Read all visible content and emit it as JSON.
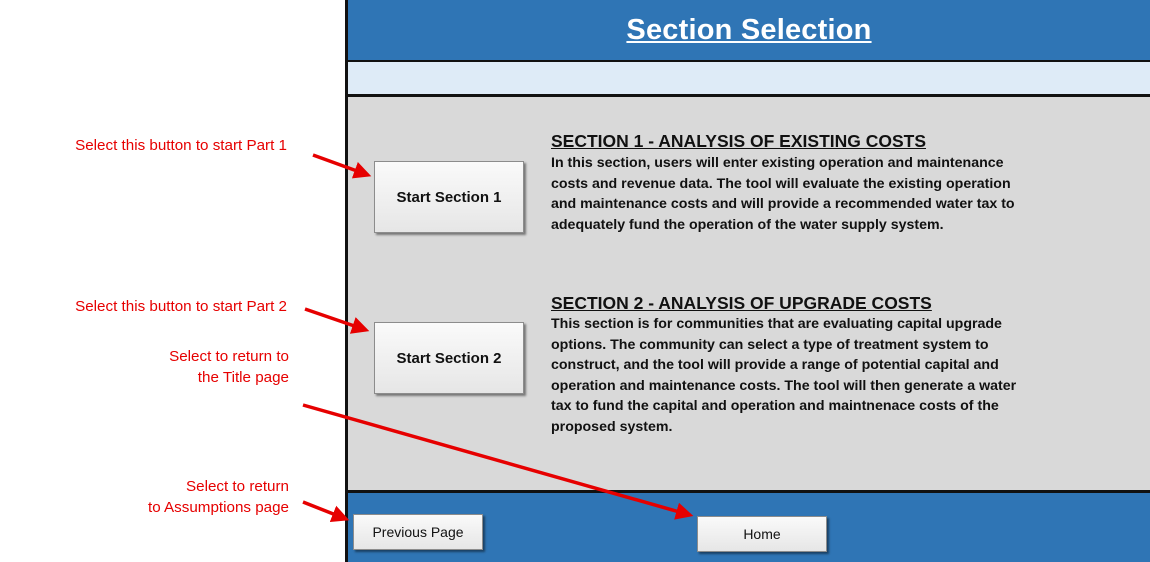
{
  "header": {
    "title": "Section Selection"
  },
  "section1": {
    "title": "SECTION 1 - ANALYSIS OF EXISTING COSTS",
    "button_label": "Start Section 1",
    "lines": [
      "In this section, users will enter existing operation and maintenance",
      "costs and revenue data. The tool will evaluate the existing operation",
      "and maintenance costs and will provide a recommended water tax to",
      "adequately fund the operation of the water supply system."
    ]
  },
  "section2": {
    "title": "SECTION 2 - ANALYSIS OF UPGRADE COSTS",
    "button_label": "Start Section 2",
    "lines": [
      "This section is for communities that are evaluating capital upgrade",
      "options. The community can select a type of treatment system to",
      "construct, and the tool will provide a range of potential capital and",
      "operation and maintenance costs. The tool will then generate a water",
      "tax to fund the capital and operation and maintnenace costs of the",
      "proposed system."
    ]
  },
  "footer": {
    "previous_label": "Previous Page",
    "home_label": "Home"
  },
  "annotations": {
    "part1": "Select this button to start Part 1",
    "part2": "Select this button to start Part 2",
    "title_page": [
      "Select to return to",
      "the Title page"
    ],
    "assumptions_page": [
      "Select to return",
      "to Assumptions page"
    ]
  },
  "colors": {
    "header_blue": "#2f75b5",
    "subbar_light_blue": "#deebf7",
    "content_gray": "#d9d9d9",
    "annotation_red": "#e60000"
  }
}
